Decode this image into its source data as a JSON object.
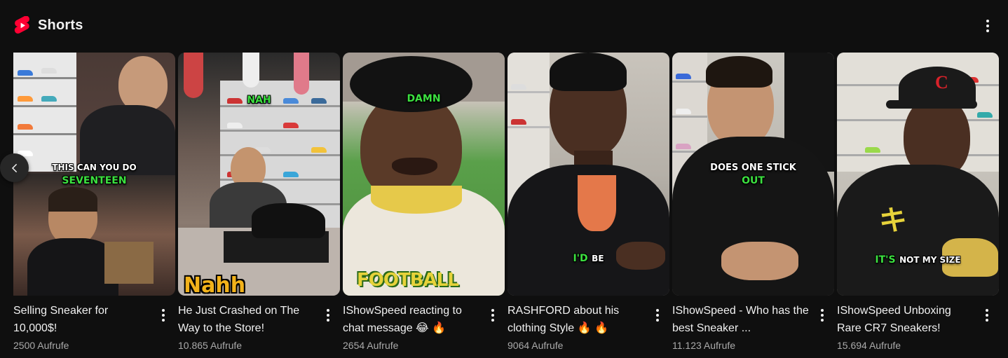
{
  "shelf": {
    "title": "Shorts"
  },
  "colors": {
    "background": "#0f0f0f",
    "brand_red": "#ff0033",
    "caption_green": "#3ce040",
    "meta_gray": "#aaaaaa"
  },
  "icons": {
    "shelf_logo": "youtube-shorts-icon",
    "menu": "more-vert-icon",
    "previous": "chevron-left-icon"
  },
  "shorts": [
    {
      "title": "Selling Sneaker for 10,000$!",
      "views": "2500 Aufrufe",
      "captions": [
        "THIS CAN YOU DO",
        "SEVENTEEN"
      ]
    },
    {
      "title": "He Just Crashed on The Way to the Store!",
      "views": "10.865 Aufrufe",
      "captions": [
        "NAH",
        "Nahh"
      ]
    },
    {
      "title": "IShowSpeed reacting to chat message 😂 🔥",
      "views": "2654 Aufrufe",
      "captions": [
        "DAMN",
        "FOOTBALL"
      ]
    },
    {
      "title": "RASHFORD about his clothing Style 🔥 🔥",
      "views": "9064 Aufrufe",
      "captions": [
        "I'D",
        "BE"
      ]
    },
    {
      "title": "IShowSpeed - Who has the best Sneaker ...",
      "views": "11.123 Aufrufe",
      "captions": [
        "DOES ONE STICK",
        "OUT"
      ]
    },
    {
      "title": "IShowSpeed Unboxing Rare CR7 Sneakers!",
      "views": "15.694 Aufrufe",
      "captions": [
        "IT'S",
        "NOT MY SIZE"
      ]
    }
  ]
}
